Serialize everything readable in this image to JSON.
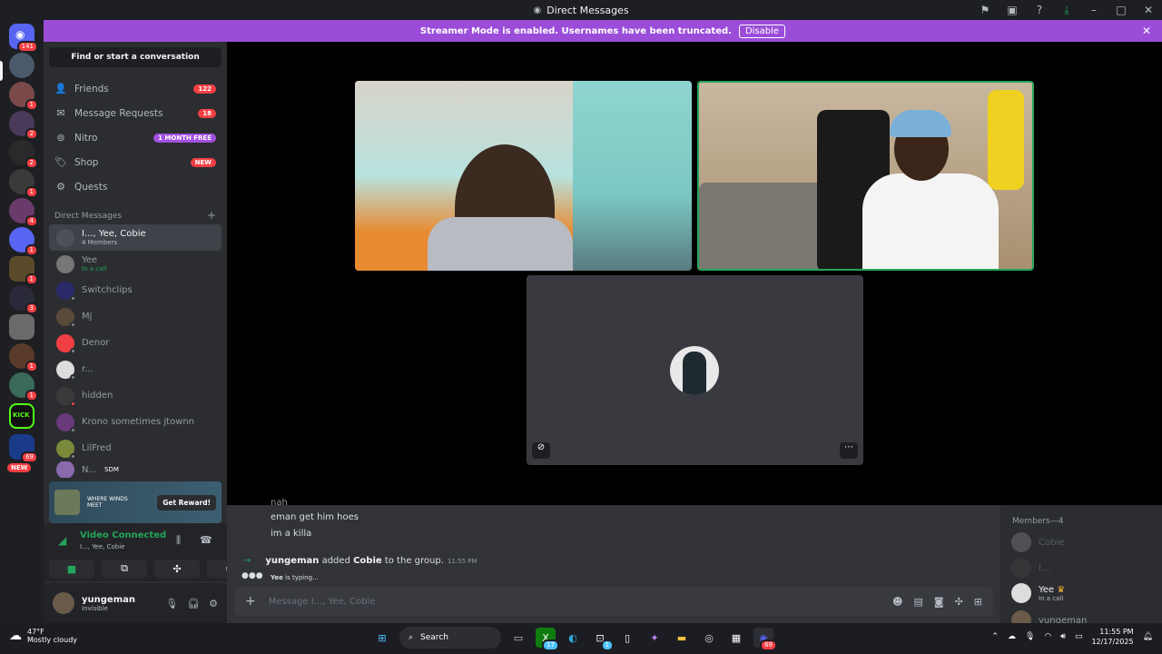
{
  "window": {
    "title": "Direct Messages"
  },
  "banner": {
    "text": "Streamer Mode is enabled. Usernames have been truncated.",
    "button": "Disable"
  },
  "guild_badges": [
    "141",
    "1",
    "2",
    "2",
    "1",
    "4",
    "1",
    "1",
    "3",
    "1",
    "1",
    "69",
    "NEW"
  ],
  "sidebar": {
    "search_label": "Find or start a conversation",
    "nav": [
      {
        "label": "Friends",
        "badge": "122"
      },
      {
        "label": "Message Requests",
        "badge": "18"
      },
      {
        "label": "Nitro",
        "badge": "1 MONTH FREE"
      },
      {
        "label": "Shop",
        "badge": "NEW"
      },
      {
        "label": "Quests",
        "badge": ""
      }
    ],
    "dm_header": "Direct Messages",
    "dm_add": "+",
    "dms": [
      {
        "name": "I..., Yee, Cobie",
        "sub": "4 Members"
      },
      {
        "name": "Yee",
        "sub": "In a call"
      },
      {
        "name": "Switchclips",
        "sub": ""
      },
      {
        "name": "Mj",
        "sub": ""
      },
      {
        "name": "Denor",
        "sub": ""
      },
      {
        "name": "r...",
        "sub": ""
      },
      {
        "name": "hidden",
        "sub": ""
      },
      {
        "name": "Krono sometimes jtownn",
        "sub": ""
      },
      {
        "name": "LilFred",
        "sub": ""
      },
      {
        "name": "N...",
        "sub": "SDM"
      }
    ]
  },
  "promo": {
    "title": "WHERE WINDS MEET",
    "button": "Get Reward!"
  },
  "voice": {
    "status": "Video Connected",
    "channel": "I..., Yee, Cobie"
  },
  "user": {
    "name": "yungeman",
    "status": "Invisible"
  },
  "chat": {
    "messages": [
      "nah",
      "eman get him hoes",
      "im a killa"
    ],
    "system": {
      "user": "yungeman",
      "action": "added",
      "target": "Cobie",
      "rest": "to the group.",
      "time": "11:55 PM"
    },
    "typing": {
      "user": "Yee",
      "text": "is typing..."
    },
    "placeholder": "Message I..., Yee, Cobie"
  },
  "members": {
    "header": "Members—4",
    "list": [
      {
        "name": "Cobie",
        "sub": ""
      },
      {
        "name": "I...",
        "sub": ""
      },
      {
        "name": "Yee",
        "sub": "In a call"
      },
      {
        "name": "yungeman",
        "sub": ""
      }
    ]
  },
  "taskbar": {
    "temp": "47°F",
    "weather": "Mostly cloudy",
    "search": "Search",
    "time": "11:55 PM",
    "date": "12/17/2025",
    "badge_a": "17",
    "badge_b": "1",
    "badge_c": "69"
  }
}
